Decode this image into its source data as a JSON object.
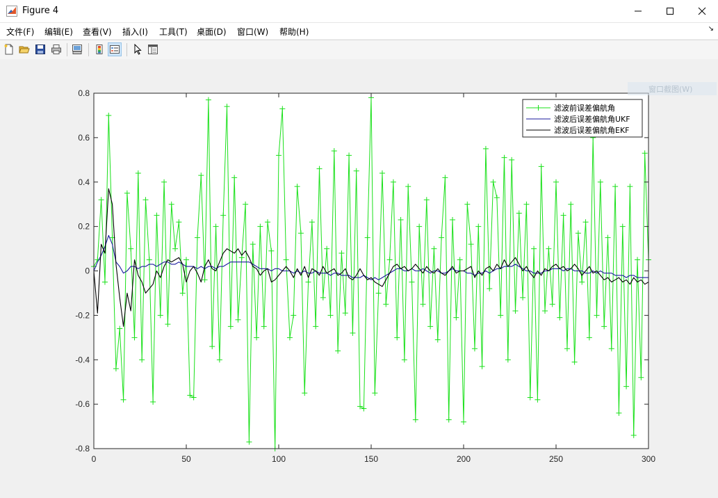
{
  "window": {
    "title": "Figure 4",
    "icon": "matlab-logo-icon"
  },
  "menu": {
    "items": [
      {
        "label": "文件(F)"
      },
      {
        "label": "编辑(E)"
      },
      {
        "label": "查看(V)"
      },
      {
        "label": "插入(I)"
      },
      {
        "label": "工具(T)"
      },
      {
        "label": "桌面(D)"
      },
      {
        "label": "窗口(W)"
      },
      {
        "label": "帮助(H)"
      }
    ],
    "corner_glyph": "↘"
  },
  "toolbar": {
    "buttons": [
      {
        "icon": "new-figure-icon"
      },
      {
        "icon": "open-file-icon"
      },
      {
        "icon": "save-icon"
      },
      {
        "icon": "print-icon"
      },
      {
        "icon": "link-plot-icon"
      },
      {
        "icon": "colorbar-icon"
      },
      {
        "icon": "legend-icon"
      },
      {
        "icon": "pointer-icon"
      },
      {
        "icon": "property-editor-icon"
      }
    ]
  },
  "ghost_tooltip": "窗口截图(W)",
  "colors": {
    "raw": "#19e019",
    "ukf": "#1a1a9e",
    "ekf": "#000000",
    "axes_bg": "#ffffff",
    "figure_bg": "#f0f0f0"
  },
  "chart_data": {
    "type": "line",
    "title": "",
    "xlabel": "",
    "ylabel": "",
    "xlim": [
      0,
      300
    ],
    "ylim": [
      -0.8,
      0.8
    ],
    "xticks": [
      "0",
      "50",
      "100",
      "150",
      "200",
      "250",
      "300"
    ],
    "yticks": [
      "-0.8",
      "-0.6",
      "-0.4",
      "-0.2",
      "0",
      "0.2",
      "0.4",
      "0.6",
      "0.8"
    ],
    "grid": false,
    "legend_position": "top-right",
    "series": [
      {
        "name": "滤波前误差偏航角",
        "marker": "+",
        "x": [
          0,
          2,
          4,
          6,
          8,
          10,
          12,
          14,
          16,
          18,
          20,
          22,
          24,
          26,
          28,
          30,
          32,
          34,
          36,
          38,
          40,
          42,
          44,
          46,
          48,
          50,
          52,
          54,
          56,
          58,
          60,
          62,
          64,
          66,
          68,
          70,
          72,
          74,
          76,
          78,
          80,
          82,
          84,
          86,
          88,
          90,
          92,
          94,
          96,
          98,
          100,
          102,
          104,
          106,
          108,
          110,
          112,
          114,
          116,
          118,
          120,
          122,
          124,
          126,
          128,
          130,
          132,
          134,
          136,
          138,
          140,
          142,
          144,
          146,
          148,
          150,
          152,
          154,
          156,
          158,
          160,
          162,
          164,
          166,
          168,
          170,
          172,
          174,
          176,
          178,
          180,
          182,
          184,
          186,
          188,
          190,
          192,
          194,
          196,
          198,
          200,
          202,
          204,
          206,
          208,
          210,
          212,
          214,
          216,
          218,
          220,
          222,
          224,
          226,
          228,
          230,
          232,
          234,
          236,
          238,
          240,
          242,
          244,
          246,
          248,
          250,
          252,
          254,
          256,
          258,
          260,
          262,
          264,
          266,
          268,
          270,
          272,
          274,
          276,
          278,
          280,
          282,
          284,
          286,
          288,
          290,
          292,
          294,
          296,
          298,
          300
        ],
        "values": [
          0.02,
          0.05,
          0.32,
          -0.05,
          0.7,
          0.15,
          -0.44,
          -0.26,
          -0.58,
          0.35,
          0.1,
          -0.3,
          0.44,
          -0.4,
          0.32,
          0.05,
          -0.59,
          0.25,
          -0.2,
          0.4,
          -0.24,
          0.3,
          0.1,
          0.22,
          -0.1,
          0.05,
          -0.56,
          -0.57,
          0.15,
          0.43,
          -0.04,
          0.77,
          -0.34,
          0.2,
          -0.4,
          0.25,
          0.74,
          -0.25,
          0.42,
          -0.22,
          0.06,
          0.3,
          -0.77,
          0.12,
          -0.3,
          0.2,
          -0.25,
          0.22,
          0.09,
          -0.8,
          0.52,
          0.73,
          0.05,
          -0.3,
          -0.2,
          0.38,
          0.17,
          -0.55,
          -0.05,
          0.22,
          -0.25,
          0.46,
          -0.12,
          0.1,
          -0.2,
          0.54,
          -0.36,
          0.08,
          -0.19,
          0.52,
          -0.28,
          0.45,
          -0.61,
          -0.62,
          0.15,
          0.78,
          -0.55,
          -0.1,
          0.44,
          -0.15,
          0.05,
          0.4,
          -0.3,
          0.23,
          -0.4,
          0.38,
          -0.05,
          -0.67,
          0.2,
          -0.15,
          0.32,
          -0.25,
          0.1,
          -0.31,
          0.15,
          0.42,
          -0.67,
          0.23,
          -0.21,
          0.05,
          -0.68,
          0.3,
          0.12,
          -0.35,
          0.2,
          -0.43,
          0.55,
          -0.08,
          0.4,
          0.33,
          -0.2,
          0.51,
          -0.4,
          0.5,
          -0.18,
          0.26,
          -0.12,
          0.3,
          -0.57,
          0.1,
          -0.58,
          0.47,
          -0.18,
          0.1,
          -0.15,
          0.4,
          -0.21,
          0.25,
          -0.35,
          0.3,
          -0.41,
          0.17,
          -0.05,
          0.22,
          -0.3,
          0.6,
          -0.2,
          0.4,
          -0.25,
          0.15,
          -0.35,
          0.38,
          -0.64,
          0.2,
          -0.52,
          0.38,
          -0.74,
          0.05,
          -0.48,
          0.53,
          0.05
        ]
      },
      {
        "name": "滤波后误差偏航角UKF",
        "marker": "none",
        "x": [
          0,
          2,
          4,
          6,
          8,
          10,
          12,
          14,
          16,
          18,
          20,
          22,
          24,
          26,
          28,
          30,
          32,
          34,
          36,
          38,
          40,
          42,
          44,
          46,
          48,
          50,
          52,
          54,
          56,
          58,
          60,
          62,
          64,
          66,
          68,
          70,
          72,
          74,
          76,
          78,
          80,
          82,
          84,
          86,
          88,
          90,
          92,
          94,
          96,
          98,
          100,
          102,
          104,
          106,
          108,
          110,
          112,
          114,
          116,
          118,
          120,
          122,
          124,
          126,
          128,
          130,
          132,
          134,
          136,
          138,
          140,
          142,
          144,
          146,
          148,
          150,
          152,
          154,
          156,
          158,
          160,
          162,
          164,
          166,
          168,
          170,
          172,
          174,
          176,
          178,
          180,
          182,
          184,
          186,
          188,
          190,
          192,
          194,
          196,
          198,
          200,
          202,
          204,
          206,
          208,
          210,
          212,
          214,
          216,
          218,
          220,
          222,
          224,
          226,
          228,
          230,
          232,
          234,
          236,
          238,
          240,
          242,
          244,
          246,
          248,
          250,
          252,
          254,
          256,
          258,
          260,
          262,
          264,
          266,
          268,
          270,
          272,
          274,
          276,
          278,
          280,
          282,
          284,
          286,
          288,
          290,
          292,
          294,
          296,
          298,
          300
        ],
        "values": [
          0.0,
          0.04,
          0.07,
          0.11,
          0.16,
          0.12,
          0.04,
          0.02,
          -0.01,
          0.0,
          0.02,
          0.02,
          0.01,
          0.02,
          0.02,
          0.03,
          0.03,
          0.02,
          0.03,
          0.04,
          0.04,
          0.03,
          0.03,
          0.04,
          0.03,
          0.02,
          0.02,
          0.02,
          0.01,
          0.02,
          0.01,
          0.02,
          0.02,
          0.01,
          0.02,
          0.02,
          0.03,
          0.04,
          0.04,
          0.04,
          0.04,
          0.04,
          0.04,
          0.03,
          0.02,
          0.01,
          0.01,
          0.01,
          0.0,
          0.01,
          0.01,
          0.0,
          0.0,
          0.0,
          -0.01,
          0.0,
          -0.01,
          0.0,
          -0.01,
          -0.01,
          0.0,
          -0.01,
          -0.01,
          -0.01,
          -0.02,
          -0.01,
          -0.01,
          -0.02,
          -0.02,
          -0.02,
          -0.03,
          -0.03,
          -0.03,
          -0.02,
          -0.03,
          -0.04,
          -0.03,
          -0.04,
          -0.03,
          -0.02,
          -0.01,
          0.0,
          0.01,
          0.01,
          0.0,
          0.0,
          0.01,
          0.0,
          0.0,
          0.01,
          0.0,
          -0.01,
          0.0,
          0.0,
          -0.01,
          -0.01,
          0.0,
          0.01,
          0.0,
          0.0,
          0.0,
          -0.01,
          -0.01,
          -0.02,
          -0.01,
          -0.01,
          0.0,
          -0.01,
          0.0,
          0.01,
          0.01,
          0.02,
          0.02,
          0.02,
          0.03,
          0.02,
          0.01,
          0.0,
          0.0,
          -0.01,
          -0.01,
          -0.01,
          0.0,
          0.0,
          0.01,
          0.01,
          0.01,
          0.0,
          0.01,
          0.01,
          0.0,
          0.0,
          0.0,
          -0.01,
          -0.01,
          0.0,
          -0.01,
          0.0,
          -0.01,
          -0.01,
          -0.01,
          -0.02,
          -0.02,
          -0.02,
          -0.03,
          -0.02,
          -0.02,
          -0.03,
          -0.03,
          -0.03,
          -0.03
        ]
      },
      {
        "name": "滤波后误差偏航角EKF",
        "marker": "none",
        "x": [
          0,
          2,
          4,
          6,
          8,
          10,
          12,
          14,
          16,
          18,
          20,
          22,
          24,
          26,
          28,
          30,
          32,
          34,
          36,
          38,
          40,
          42,
          44,
          46,
          48,
          50,
          52,
          54,
          56,
          58,
          60,
          62,
          64,
          66,
          68,
          70,
          72,
          74,
          76,
          78,
          80,
          82,
          84,
          86,
          88,
          90,
          92,
          94,
          96,
          98,
          100,
          102,
          104,
          106,
          108,
          110,
          112,
          114,
          116,
          118,
          120,
          122,
          124,
          126,
          128,
          130,
          132,
          134,
          136,
          138,
          140,
          142,
          144,
          146,
          148,
          150,
          152,
          154,
          156,
          158,
          160,
          162,
          164,
          166,
          168,
          170,
          172,
          174,
          176,
          178,
          180,
          182,
          184,
          186,
          188,
          190,
          192,
          194,
          196,
          198,
          200,
          202,
          204,
          206,
          208,
          210,
          212,
          214,
          216,
          218,
          220,
          222,
          224,
          226,
          228,
          230,
          232,
          234,
          236,
          238,
          240,
          242,
          244,
          246,
          248,
          250,
          252,
          254,
          256,
          258,
          260,
          262,
          264,
          266,
          268,
          270,
          272,
          274,
          276,
          278,
          280,
          282,
          284,
          286,
          288,
          290,
          292,
          294,
          296,
          298,
          300
        ],
        "values": [
          0.0,
          -0.19,
          0.12,
          0.08,
          0.37,
          0.3,
          0.03,
          -0.12,
          -0.25,
          -0.1,
          -0.18,
          0.05,
          -0.02,
          -0.05,
          -0.1,
          -0.08,
          -0.06,
          0.0,
          -0.03,
          0.02,
          0.05,
          0.04,
          0.05,
          0.06,
          0.03,
          -0.05,
          0.0,
          0.02,
          -0.01,
          -0.05,
          0.02,
          0.05,
          0.01,
          0.0,
          0.04,
          0.08,
          0.1,
          0.09,
          0.08,
          0.1,
          0.07,
          0.09,
          0.06,
          0.02,
          0.01,
          -0.02,
          0.0,
          0.01,
          -0.05,
          -0.04,
          -0.02,
          0.0,
          0.02,
          0.0,
          -0.03,
          0.01,
          -0.02,
          0.02,
          -0.03,
          0.01,
          0.0,
          -0.02,
          0.02,
          -0.01,
          0.0,
          0.01,
          -0.02,
          -0.01,
          0.01,
          -0.03,
          -0.04,
          -0.02,
          0.01,
          -0.02,
          -0.04,
          -0.03,
          -0.05,
          -0.06,
          -0.07,
          -0.04,
          -0.01,
          0.02,
          0.03,
          0.01,
          0.02,
          0.0,
          0.01,
          0.03,
          0.01,
          -0.01,
          0.02,
          0.0,
          -0.01,
          0.01,
          -0.01,
          -0.02,
          0.0,
          0.02,
          -0.01,
          0.0,
          0.0,
          0.01,
          0.02,
          -0.03,
          0.0,
          -0.02,
          0.01,
          0.02,
          0.0,
          0.03,
          0.01,
          0.05,
          0.02,
          0.04,
          0.06,
          0.03,
          0.0,
          0.02,
          -0.01,
          -0.03,
          0.0,
          -0.02,
          0.01,
          0.0,
          0.02,
          0.03,
          0.01,
          0.02,
          0.0,
          0.01,
          0.03,
          0.01,
          -0.02,
          0.0,
          0.02,
          -0.01,
          0.0,
          -0.02,
          -0.04,
          -0.03,
          -0.05,
          -0.04,
          -0.03,
          -0.05,
          -0.04,
          -0.06,
          -0.03,
          -0.05,
          -0.04,
          -0.06,
          -0.05
        ]
      }
    ]
  }
}
